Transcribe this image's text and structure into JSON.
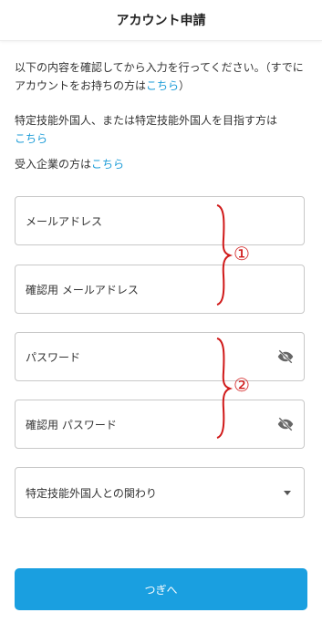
{
  "header": {
    "title": "アカウント申請"
  },
  "intro": {
    "text": "以下の内容を確認してから入力を行ってください。（すでにアカウントをお持ちの方は",
    "link": "こちら",
    "suffix": "）"
  },
  "specified": {
    "text": "特定技能外国人、または特定技能外国人を目指す方は",
    "link": "こちら"
  },
  "company": {
    "text": "受入企業の方は",
    "link": "こちら"
  },
  "form": {
    "email_placeholder": "メールアドレス",
    "email_confirm_placeholder": "確認用 メールアドレス",
    "password_placeholder": "パスワード",
    "password_confirm_placeholder": "確認用 パスワード",
    "relation_select": "特定技能外国人との関わり"
  },
  "annotations": {
    "group1": "①",
    "group2": "②",
    "color": "#d01919"
  },
  "next_button": {
    "label": "つぎへ",
    "color": "#1a9fe0"
  },
  "icons": {
    "password_toggle": "eye-off-icon",
    "select_arrow": "caret-down-icon"
  }
}
